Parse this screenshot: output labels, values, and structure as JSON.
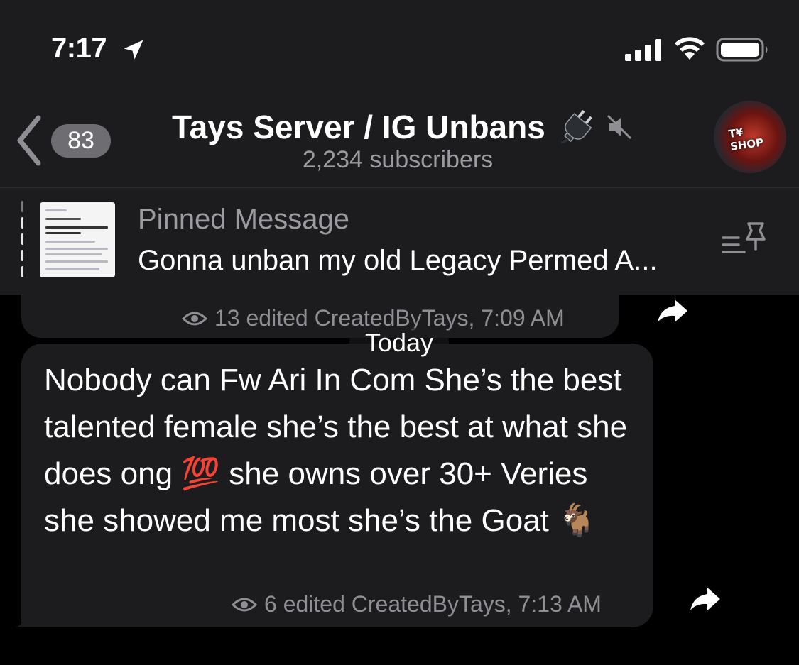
{
  "status_bar": {
    "time": "7:17"
  },
  "header": {
    "back_count": "83",
    "title": "Tays Server / IG Unbans",
    "subtitle": "2,234 subscribers"
  },
  "pinned": {
    "label": "Pinned Message",
    "text": "Gonna unban my old Legacy Permed A..."
  },
  "previous_message": {
    "views": "13",
    "meta": "edited CreatedByTays, 7:09 AM"
  },
  "date_separator": "Today",
  "message": {
    "text_before_100": "Nobody can Fw Ari In Com She’s the best talented female she’s the best at what she does ong ",
    "emoji_100": "💯",
    "text_after_100": " she owns over 30+ Veries she showed me most she’s the Goat ",
    "emoji_goat": "🐐",
    "views": "6",
    "meta": "edited CreatedByTays, 7:13 AM"
  },
  "icons": {
    "location": "location-arrow-icon",
    "signal": "signal-icon",
    "wifi": "wifi-icon",
    "battery": "battery-icon",
    "back": "chevron-left-icon",
    "plug": "plug-icon",
    "mute": "muted-icon",
    "pin_list": "pin-list-icon",
    "eye": "eye-icon",
    "forward": "forward-arrow-icon"
  }
}
